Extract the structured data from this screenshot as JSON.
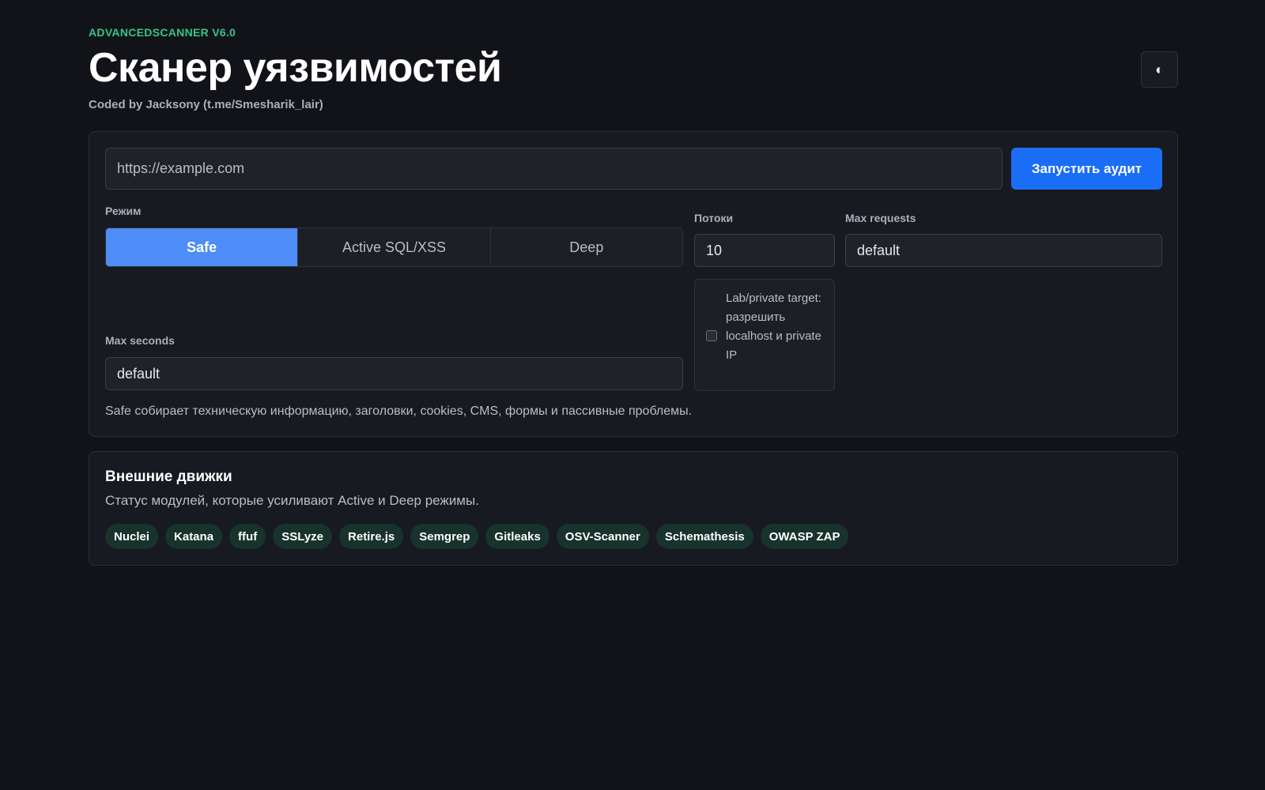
{
  "header": {
    "brand": "ADVANCEDSCANNER V6.0",
    "title": "Сканер уязвимостей",
    "subtitle": "Coded by Jacksony (t.me/Smesharik_lair)",
    "theme_toggle_icon": "◐"
  },
  "scan": {
    "url_placeholder": "https://example.com",
    "url_value": "",
    "run_label": "Запустить аудит",
    "mode_label": "Режим",
    "modes": [
      "Safe",
      "Active SQL/XSS",
      "Deep"
    ],
    "selected_mode": "Safe",
    "threads_label": "Потоки",
    "threads_value": "10",
    "max_requests_label": "Max requests",
    "max_requests_value": "default",
    "max_seconds_label": "Max seconds",
    "max_seconds_value": "default",
    "lab_text": "Lab/private target: разрешить localhost и private IP",
    "lab_checked": false,
    "hint": "Safe собирает техническую информацию, заголовки, cookies, CMS, формы и пассивные проблемы."
  },
  "engines": {
    "title": "Внешние движки",
    "description": "Статус модулей, которые усиливают Active и Deep режимы.",
    "items": [
      "Nuclei",
      "Katana",
      "ffuf",
      "SSLyze",
      "Retire.js",
      "Semgrep",
      "Gitleaks",
      "OSV-Scanner",
      "Schemathesis",
      "OWASP ZAP"
    ]
  },
  "colors": {
    "accent": "#1a6ef5",
    "brand": "#35c48a",
    "active_segment": "#4e8cf7",
    "chip_bg": "#17332c"
  }
}
